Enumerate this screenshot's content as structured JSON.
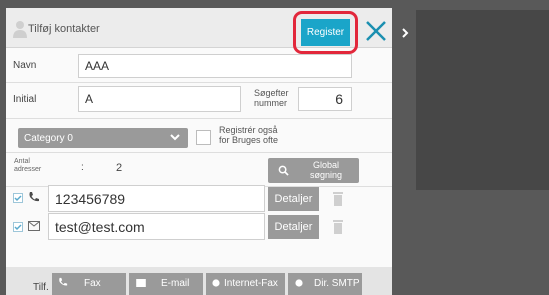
{
  "header": {
    "title": "Tilføj kontakter",
    "register_label": "Register"
  },
  "form": {
    "name_label": "Navn",
    "name_value": "AAA",
    "initial_label": "Initial",
    "initial_value": "A",
    "search_number_label_line1": "Søgefter",
    "search_number_label_line2": "nummer",
    "search_number_value": "6",
    "category_value": "Category 0",
    "register_also_line1": "Registrér også",
    "register_also_line2": "for Bruges ofte",
    "address_count_label_line1": "Antal",
    "address_count_label_line2": "adresser",
    "address_count_separator": ":",
    "address_count_value": "2",
    "global_search_line1": "Global",
    "global_search_line2": "søgning"
  },
  "addresses": [
    {
      "type": "phone",
      "value": "123456789",
      "detail_label": "Detaljer"
    },
    {
      "type": "email",
      "value": "test@test.com",
      "detail_label": "Detaljer"
    }
  ],
  "bottom": {
    "tilf_label": "Tilf.",
    "tabs": [
      "Fax",
      "E-mail",
      "Internet-Fax",
      "Dir. SMTP"
    ]
  },
  "colors": {
    "accent": "#1aa5c9",
    "highlight": "#e2273b",
    "button_gray": "#9a9a9a"
  }
}
